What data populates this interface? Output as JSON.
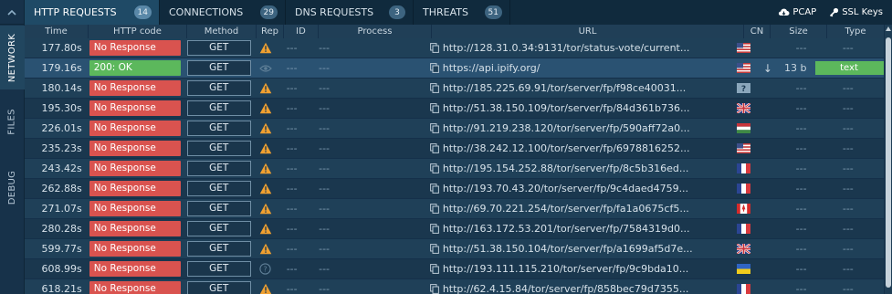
{
  "sidebar": {
    "top_icon": "collapse-chevron-icon",
    "items": [
      {
        "label": "NETWORK",
        "active": true
      },
      {
        "label": "FILES",
        "active": false
      },
      {
        "label": "DEBUG",
        "active": false
      }
    ]
  },
  "tabs": [
    {
      "label": "HTTP REQUESTS",
      "count": "14",
      "active": true
    },
    {
      "label": "CONNECTIONS",
      "count": "29",
      "active": false
    },
    {
      "label": "DNS REQUESTS",
      "count": "3",
      "active": false
    },
    {
      "label": "THREATS",
      "count": "51",
      "active": false
    }
  ],
  "actions": {
    "pcap_label": "PCAP",
    "ssl_label": "SSL Keys"
  },
  "columns": {
    "time": "Time",
    "http_code": "HTTP code",
    "method": "Method",
    "rep": "Rep",
    "id": "ID",
    "process": "Process",
    "url": "URL",
    "cn": "CN",
    "size": "Size",
    "type": "Type"
  },
  "colors": {
    "error_pill": "#d9534f",
    "ok_pill": "#5cb85c",
    "warning_icon": "#f0a030"
  },
  "rows": [
    {
      "time": "177.80s",
      "code": "No Response",
      "status": "err",
      "method": "GET",
      "rep": "warning",
      "id": "---",
      "process": "---",
      "url": "http://128.31.0.34:9131/tor/status-vote/current...",
      "cn": "us",
      "arrow": "",
      "size": "---",
      "type": "---"
    },
    {
      "time": "179.16s",
      "code": "200: OK",
      "status": "ok",
      "method": "GET",
      "rep": "eye",
      "id": "---",
      "process": "---",
      "url": "https://api.ipify.org/",
      "cn": "us",
      "arrow": "↓",
      "size": "13 b",
      "type": "text"
    },
    {
      "time": "180.14s",
      "code": "No Response",
      "status": "err",
      "method": "GET",
      "rep": "warning",
      "id": "---",
      "process": "---",
      "url": "http://185.225.69.91/tor/server/fp/f98ce40031...",
      "cn": "unknown",
      "arrow": "",
      "size": "---",
      "type": "---"
    },
    {
      "time": "195.30s",
      "code": "No Response",
      "status": "err",
      "method": "GET",
      "rep": "warning",
      "id": "---",
      "process": "---",
      "url": "http://51.38.150.109/tor/server/fp/84d361b736...",
      "cn": "gb",
      "arrow": "",
      "size": "---",
      "type": "---"
    },
    {
      "time": "226.01s",
      "code": "No Response",
      "status": "err",
      "method": "GET",
      "rep": "warning",
      "id": "---",
      "process": "---",
      "url": "http://91.219.238.120/tor/server/fp/590aff72a0...",
      "cn": "hu",
      "arrow": "",
      "size": "---",
      "type": "---"
    },
    {
      "time": "235.23s",
      "code": "No Response",
      "status": "err",
      "method": "GET",
      "rep": "warning",
      "id": "---",
      "process": "---",
      "url": "http://38.242.12.100/tor/server/fp/6978816252...",
      "cn": "us",
      "arrow": "",
      "size": "---",
      "type": "---"
    },
    {
      "time": "243.42s",
      "code": "No Response",
      "status": "err",
      "method": "GET",
      "rep": "warning",
      "id": "---",
      "process": "---",
      "url": "http://195.154.252.88/tor/server/fp/8c5b316ed...",
      "cn": "fr",
      "arrow": "",
      "size": "---",
      "type": "---"
    },
    {
      "time": "262.88s",
      "code": "No Response",
      "status": "err",
      "method": "GET",
      "rep": "warning",
      "id": "---",
      "process": "---",
      "url": "http://193.70.43.20/tor/server/fp/9c4daed4759...",
      "cn": "fr",
      "arrow": "",
      "size": "---",
      "type": "---"
    },
    {
      "time": "271.07s",
      "code": "No Response",
      "status": "err",
      "method": "GET",
      "rep": "warning",
      "id": "---",
      "process": "---",
      "url": "http://69.70.221.254/tor/server/fp/fa1a0675cf5...",
      "cn": "ca",
      "arrow": "",
      "size": "---",
      "type": "---"
    },
    {
      "time": "280.28s",
      "code": "No Response",
      "status": "err",
      "method": "GET",
      "rep": "warning",
      "id": "---",
      "process": "---",
      "url": "http://163.172.53.201/tor/server/fp/7584319d0...",
      "cn": "fr",
      "arrow": "",
      "size": "---",
      "type": "---"
    },
    {
      "time": "599.77s",
      "code": "No Response",
      "status": "err",
      "method": "GET",
      "rep": "warning",
      "id": "---",
      "process": "---",
      "url": "http://51.38.150.104/tor/server/fp/a1699af5d7e...",
      "cn": "gb",
      "arrow": "",
      "size": "---",
      "type": "---"
    },
    {
      "time": "608.99s",
      "code": "No Response",
      "status": "err",
      "method": "GET",
      "rep": "question",
      "id": "---",
      "process": "---",
      "url": "http://193.111.115.210/tor/server/fp/9c9bda10...",
      "cn": "ua",
      "arrow": "",
      "size": "---",
      "type": "---"
    },
    {
      "time": "618.21s",
      "code": "No Response",
      "status": "err",
      "method": "GET",
      "rep": "warning",
      "id": "---",
      "process": "---",
      "url": "http://62.4.15.84/tor/server/fp/858bec79d7355...",
      "cn": "fr",
      "arrow": "",
      "size": "---",
      "type": "---"
    }
  ]
}
